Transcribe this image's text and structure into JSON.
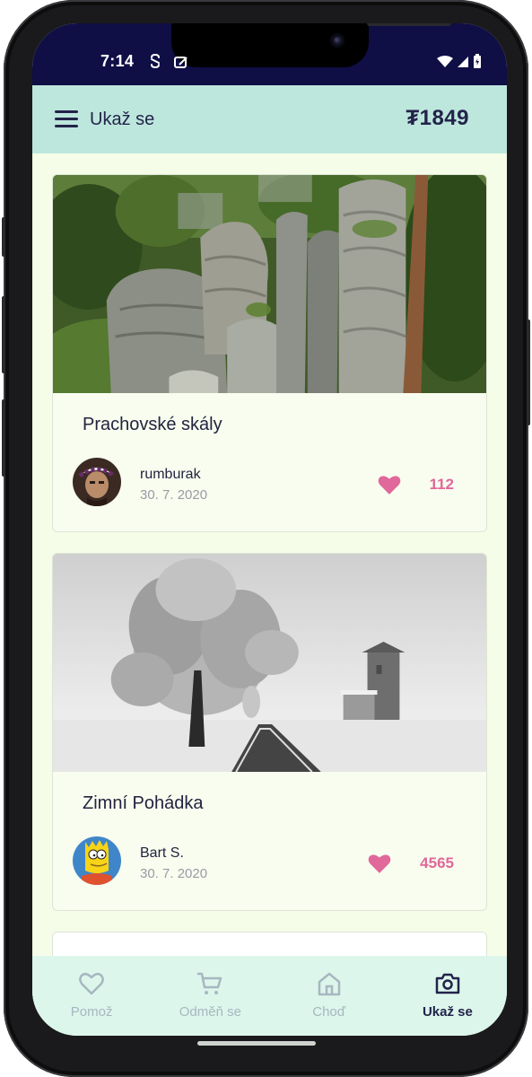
{
  "status_bar": {
    "time": "7:14",
    "icons": [
      "sync-icon",
      "screenshot-icon",
      "wifi-icon",
      "signal-icon",
      "battery-icon"
    ]
  },
  "app_bar": {
    "title": "Ukaž se",
    "balance": "₮1849",
    "menu_icon": "hamburger-icon"
  },
  "colors": {
    "status_bar": "#0f0e45",
    "app_bar": "#bde7dd",
    "background": "#f5fde8",
    "nav_bar": "#dcf6eb",
    "accent_like": "#e0689a",
    "text_dark": "#23234a",
    "nav_inactive": "#a7b7c0"
  },
  "feed": {
    "posts": [
      {
        "title": "Prachovské skály",
        "author": "rumburak",
        "date": "30. 7. 2020",
        "likes": "112",
        "photo": "rock-towers-forest-photo",
        "avatar": "person-with-checkered-hat-avatar"
      },
      {
        "title": "Zimní Pohádka",
        "author": "Bart S.",
        "date": "30. 7. 2020",
        "likes": "4565",
        "photo": "snowy-tree-and-tower-photo",
        "avatar": "cartoon-character-avatar"
      }
    ]
  },
  "bottom_nav": {
    "items": [
      {
        "label": "Pomož",
        "icon": "heart-outline-icon",
        "active": false
      },
      {
        "label": "Odměň se",
        "icon": "cart-icon",
        "active": false
      },
      {
        "label": "Choď",
        "icon": "home-icon",
        "active": false
      },
      {
        "label": "Ukaž se",
        "icon": "camera-icon",
        "active": true
      }
    ]
  }
}
